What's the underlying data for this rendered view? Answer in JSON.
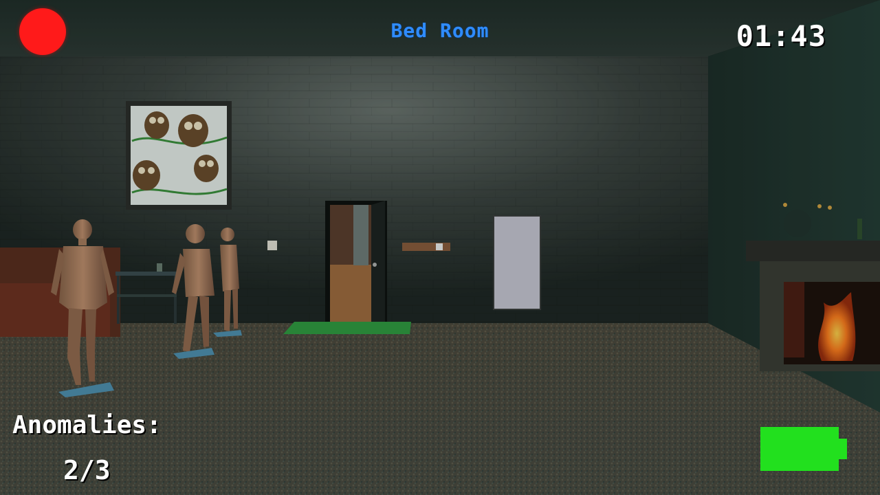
{
  "hud": {
    "room_name": "Bed Room",
    "timer": "01:43",
    "anomalies_label": "Anomalies:",
    "anomalies_count": "2/3",
    "recording": true,
    "battery_level": 1.0
  },
  "colors": {
    "recording_dot": "#ff1a1a",
    "room_name": "#2f8cff",
    "battery": "#22e01e",
    "hud_text": "#ffffff"
  },
  "scene": {
    "objects": [
      "owl-painting",
      "doorway",
      "light-switch",
      "wall-hook-rack",
      "wall-mirror",
      "fireplace",
      "mannequin",
      "mannequin",
      "mannequin",
      "side-table",
      "sofa",
      "green-doormat"
    ]
  }
}
